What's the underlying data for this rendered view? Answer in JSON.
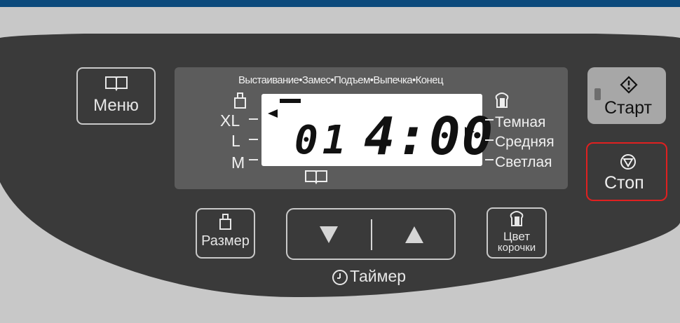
{
  "menu_button": {
    "label": "Меню",
    "icon": "book-icon"
  },
  "lcd": {
    "stages": "Выстаивание•Замес•Подъем•Выпечка•Конец",
    "size_labels": [
      "XL",
      "L",
      "M"
    ],
    "program_number": "01",
    "time": "4:00",
    "crust_labels": [
      "Темная",
      "Средняя",
      "Светлая"
    ]
  },
  "start_button": {
    "label": "Старт"
  },
  "stop_button": {
    "label": "Стоп"
  },
  "size_button": {
    "label": "Размер"
  },
  "timer": {
    "label": "Таймер",
    "down_icon": "triangle-down-icon",
    "up_icon": "triangle-up-icon"
  },
  "crust_button": {
    "label_line1": "Цвет",
    "label_line2": "корочки"
  }
}
